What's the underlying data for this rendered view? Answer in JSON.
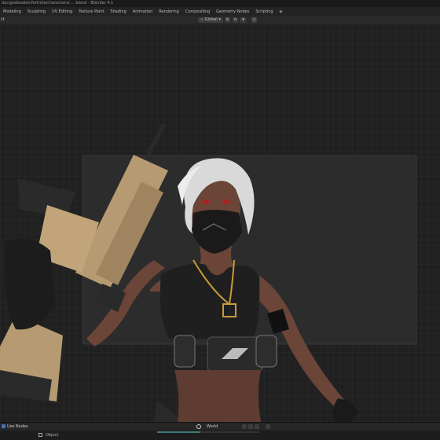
{
  "window": {
    "title": "doc/godesalen/fortnite/characters/... .blend - Blender 4.1"
  },
  "workspace_tabs": [
    {
      "label": "Modeling",
      "active": false
    },
    {
      "label": "Sculpting",
      "active": false
    },
    {
      "label": "UV Editing",
      "active": false
    },
    {
      "label": "Texture Paint",
      "active": false
    },
    {
      "label": "Shading",
      "active": false
    },
    {
      "label": "Animation",
      "active": false
    },
    {
      "label": "Rendering",
      "active": false
    },
    {
      "label": "Compositing",
      "active": false
    },
    {
      "label": "Geometry Nodes",
      "active": false
    },
    {
      "label": "Scripting",
      "active": false
    }
  ],
  "workspace_add": "+",
  "toolbar": {
    "left_label": "ct",
    "transform_orientation": "Global",
    "transform_orientation_icon": "axes-icon",
    "pivot_icon": "chevron-down-icon",
    "snap_icon": "magnet-icon",
    "proportional_icon": "circle-icon"
  },
  "viewport": {
    "scene": "3D render preview of a character with white hair, black face mask and a tan assault rifle",
    "colors": {
      "background": "#202020",
      "render_region": "#2c2c2c",
      "rifle": "#b69a72",
      "hair": "#d9d9d9",
      "skin": "#6b4538",
      "outfit": "#1f1f1f",
      "necklace": "#c99a3a"
    }
  },
  "status": {
    "use_nodes_label": "Use Nodes",
    "use_nodes_checked": true,
    "world_label": "World",
    "world_icon": "world-icon"
  },
  "bottom": {
    "mode_label": "Object",
    "mode_icon": "object-icon",
    "render_progress": 0.42
  }
}
